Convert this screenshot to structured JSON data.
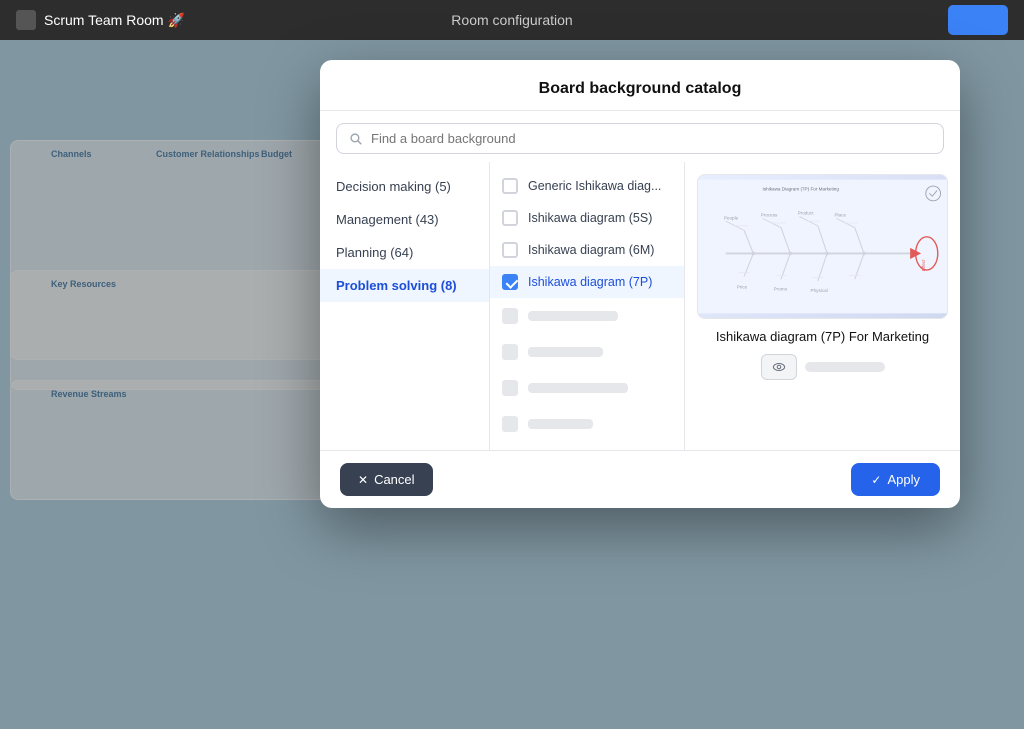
{
  "titleBar": {
    "appTitle": "Scrum Team Room 🚀",
    "centerTitle": "Room configuration",
    "actionBtn": ""
  },
  "dialog": {
    "title": "Board background catalog",
    "searchPlaceholder": "Find a board background",
    "categories": [
      {
        "id": "decision-making",
        "label": "Decision making (5)",
        "active": false
      },
      {
        "id": "management",
        "label": "Management (43)",
        "active": false
      },
      {
        "id": "planning",
        "label": "Planning (64)",
        "active": false
      },
      {
        "id": "problem-solving",
        "label": "Problem solving (8)",
        "active": true
      }
    ],
    "bgItems": [
      {
        "id": "generic-ishikawa",
        "label": "Generic Ishikawa diag...",
        "selected": false
      },
      {
        "id": "ishikawa-5s",
        "label": "Ishikawa diagram (5S)",
        "selected": false
      },
      {
        "id": "ishikawa-6m",
        "label": "Ishikawa diagram (6M)",
        "selected": false
      },
      {
        "id": "ishikawa-7p",
        "label": "Ishikawa diagram (7P)",
        "selected": true
      }
    ],
    "preview": {
      "title": "Ishikawa diagram (7P) For Marketing"
    },
    "cancelLabel": "Cancel",
    "applyLabel": "Apply"
  }
}
